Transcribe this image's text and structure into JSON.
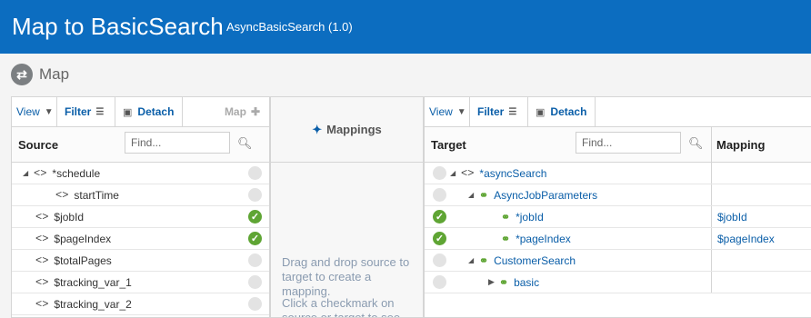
{
  "header": {
    "title": "Map to BasicSearch",
    "subtitle": "AsyncBasicSearch (1.0)"
  },
  "section": {
    "label": "Map"
  },
  "source": {
    "toolbar": {
      "view": "View",
      "filter": "Filter",
      "detach": "Detach",
      "map": "Map"
    },
    "column_header": "Source",
    "find_placeholder": "Find...",
    "rows": [
      {
        "label": "*schedule",
        "status": "unmapped"
      },
      {
        "label": "startTime",
        "status": "unmapped"
      },
      {
        "label": "$jobId",
        "status": "mapped"
      },
      {
        "label": "$pageIndex",
        "status": "mapped"
      },
      {
        "label": "$totalPages",
        "status": "unmapped"
      },
      {
        "label": "$tracking_var_1",
        "status": "unmapped"
      },
      {
        "label": "$tracking_var_2",
        "status": "unmapped"
      }
    ]
  },
  "mappings": {
    "title": "Mappings",
    "hint1": "Drag and drop source to target to create a mapping.",
    "hint2": "Click a checkmark on source or target to see"
  },
  "target": {
    "toolbar": {
      "view": "View",
      "filter": "Filter",
      "detach": "Detach"
    },
    "column_header": "Target",
    "mapping_header": "Mapping",
    "find_placeholder": "Find...",
    "rows": [
      {
        "label": "*asyncSearch",
        "status": "unmapped",
        "mapping": ""
      },
      {
        "label": "AsyncJobParameters",
        "status": "unmapped",
        "mapping": ""
      },
      {
        "label": "*jobId",
        "status": "mapped",
        "mapping": "$jobId"
      },
      {
        "label": "*pageIndex",
        "status": "mapped",
        "mapping": "$pageIndex"
      },
      {
        "label": "CustomerSearch",
        "status": "unmapped",
        "mapping": ""
      },
      {
        "label": "basic",
        "status": "unmapped",
        "mapping": ""
      }
    ]
  },
  "colors": {
    "banner": "#0c6dc0",
    "link": "#0a5ea8",
    "ok": "#5fa534"
  }
}
